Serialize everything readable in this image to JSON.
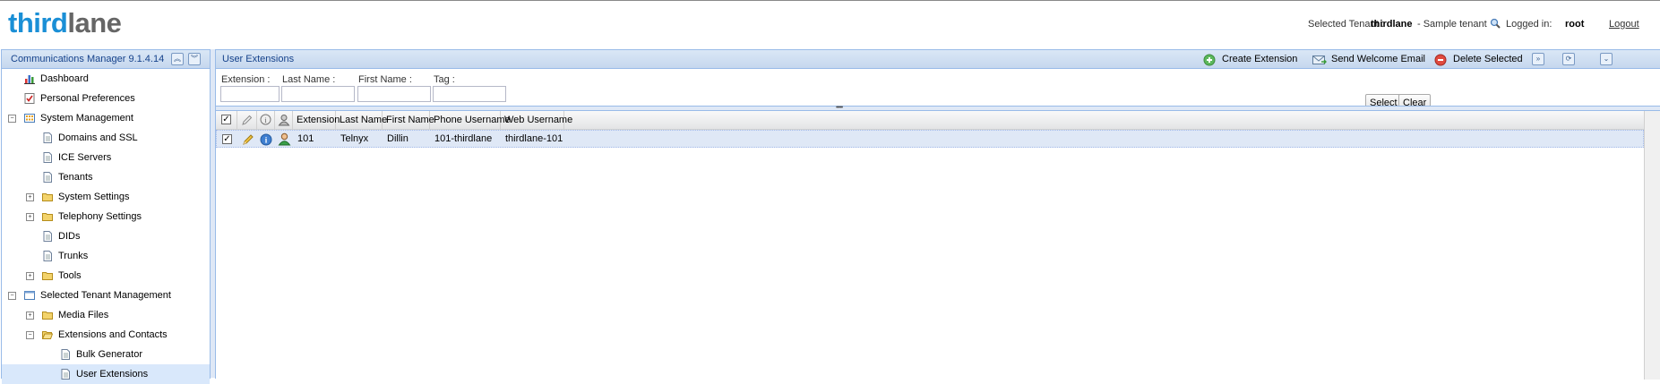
{
  "header": {
    "logo_part1": "third",
    "logo_part2": "lane",
    "selected_tenant_label": "Selected Tenant :",
    "tenant_name": "thirdlane",
    "tenant_desc": "- Sample tenant",
    "logged_in_label": "Logged in:",
    "user": "root",
    "logout": "Logout"
  },
  "sidebar": {
    "title": "Communications Manager 9.1.4.14",
    "items": [
      {
        "label": "Dashboard",
        "icon": "dashboard-icon"
      },
      {
        "label": "Personal Preferences",
        "icon": "checklist-icon"
      },
      {
        "label": "System Management",
        "icon": "grid-icon",
        "expanded": true
      },
      {
        "label": "Domains and SSL",
        "icon": "page-icon"
      },
      {
        "label": "ICE Servers",
        "icon": "page-icon"
      },
      {
        "label": "Tenants",
        "icon": "page-icon"
      },
      {
        "label": "System Settings",
        "icon": "folder-icon",
        "expanded": false
      },
      {
        "label": "Telephony Settings",
        "icon": "folder-icon",
        "expanded": false
      },
      {
        "label": "DIDs",
        "icon": "page-icon"
      },
      {
        "label": "Trunks",
        "icon": "page-icon"
      },
      {
        "label": "Tools",
        "icon": "folder-icon",
        "expanded": false
      },
      {
        "label": "Selected Tenant Management",
        "icon": "window-icon",
        "expanded": true
      },
      {
        "label": "Media Files",
        "icon": "folder-icon",
        "expanded": false
      },
      {
        "label": "Extensions and Contacts",
        "icon": "folder-icon",
        "expanded": true
      },
      {
        "label": "Bulk Generator",
        "icon": "page-icon"
      },
      {
        "label": "User Extensions",
        "icon": "page-icon",
        "selected": true
      }
    ]
  },
  "main": {
    "title": "User Extensions",
    "toolbar": {
      "create": "Create Extension",
      "welcome": "Send Welcome Email",
      "delete": "Delete Selected"
    },
    "filters": {
      "extension_label": "Extension :",
      "lastname_label": "Last Name :",
      "firstname_label": "First Name :",
      "tag_label": "Tag :",
      "extension_value": "",
      "lastname_value": "",
      "firstname_value": "",
      "tag_value": ""
    },
    "buttons": {
      "select": "Select",
      "clear": "Clear"
    },
    "columns": [
      "Extension",
      "Last Name",
      "First Name",
      "Phone Username",
      "Web Username"
    ],
    "rows": [
      {
        "extension": "101",
        "last_name": "Telnyx",
        "first_name": "Dillin",
        "phone_username": "101-thirdlane",
        "web_username": "thirdlane-101",
        "checked": true
      }
    ]
  },
  "colors": {
    "brand_blue": "#1a8fd6",
    "logo_gray": "#666666",
    "panel_title": "#15428b"
  }
}
